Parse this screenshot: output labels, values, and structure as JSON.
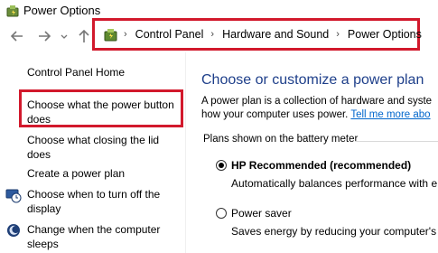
{
  "window": {
    "title": "Power Options"
  },
  "address_bar": {
    "crumbs": [
      "Control Panel",
      "Hardware and Sound",
      "Power Options"
    ]
  },
  "left_pane": {
    "home": "Control Panel Home",
    "links": [
      {
        "label_line1": "Choose what the power button",
        "label_line2": "does"
      },
      {
        "label_line1": "Choose what closing the lid",
        "label_line2": "does"
      },
      {
        "label_line1": "Create a power plan"
      },
      {
        "label_line1": "Choose when to turn off the",
        "label_line2": "display",
        "icon": "display-schedule-icon"
      },
      {
        "label_line1": "Change when the computer",
        "label_line2": "sleeps",
        "icon": "sleep-moon-icon"
      }
    ]
  },
  "main": {
    "heading": "Choose or customize a power plan",
    "desc_line1": "A power plan is a collection of hardware and syste",
    "desc_line2": "how your computer uses power. ",
    "desc_link": "Tell me more abo",
    "section_label": "Plans shown on the battery meter",
    "plans": [
      {
        "name": "HP Recommended (recommended)",
        "desc": "Automatically balances performance with e",
        "selected": true
      },
      {
        "name": "Power saver",
        "desc": "Saves energy by reducing your computer's p",
        "selected": false
      }
    ]
  },
  "colors": {
    "accent_link": "#0066cc",
    "heading": "#1e3f8a",
    "highlight": "#d2192c"
  }
}
